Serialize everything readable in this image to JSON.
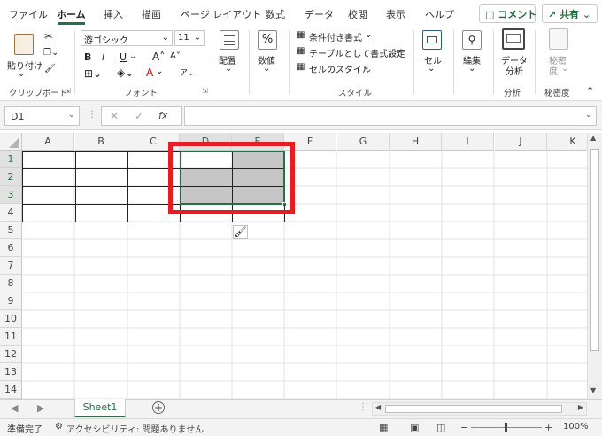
{
  "ribbon_tabs": [
    "ファイル",
    "ホーム",
    "挿入",
    "描画",
    "ページ レイアウト",
    "数式",
    "データ",
    "校閲",
    "表示",
    "ヘルプ"
  ],
  "comment_button": "コメント",
  "share_button": "共有",
  "clipboard": {
    "paste_label": "貼り付け",
    "group_label": "クリップボード"
  },
  "font": {
    "name": "游ゴシック",
    "size": "11",
    "group_label": "フォント",
    "bold": "B",
    "italic": "I",
    "underline": "U",
    "font_color_letter": "A"
  },
  "alignment": {
    "label": "配置"
  },
  "number": {
    "label": "数値"
  },
  "styles": {
    "conditional": "条件付き書式",
    "table": "テーブルとして書式設定",
    "cell_styles": "セルのスタイル",
    "group_label": "スタイル"
  },
  "cells": {
    "label": "セル"
  },
  "editing": {
    "label": "編集"
  },
  "analysis": {
    "btn_line1": "データ",
    "btn_line2": "分析",
    "group_label": "分析"
  },
  "sensitivity": {
    "btn_line1": "秘密",
    "btn_line2": "度",
    "group_label": "秘密度"
  },
  "formula_bar": {
    "name_box": "D1",
    "fx": "fx",
    "formula": ""
  },
  "columns": [
    "A",
    "B",
    "C",
    "D",
    "E",
    "F",
    "G",
    "H",
    "I",
    "J",
    "K"
  ],
  "rows": [
    "1",
    "2",
    "3",
    "4",
    "5",
    "6",
    "7",
    "8",
    "9",
    "10",
    "11",
    "12",
    "13",
    "14"
  ],
  "selected_range": "D1:E3",
  "sheet_tab": "Sheet1",
  "status": {
    "ready": "準備完了",
    "accessibility": "アクセシビリティ: 問題ありません",
    "zoom": "100%"
  },
  "colors": {
    "accent": "#217346",
    "highlight_box": "#e31e24",
    "selection_fill": "#c6c6c6"
  }
}
